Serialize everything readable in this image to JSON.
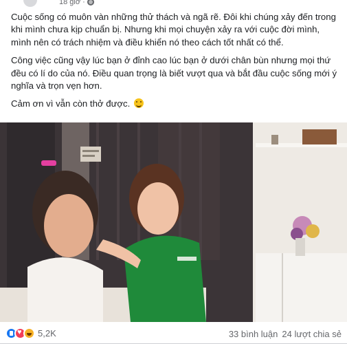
{
  "header": {
    "time": "18 giờ",
    "privacy_icon": "globe-icon"
  },
  "post": {
    "paragraphs": [
      "Cuộc sống có muôn vàn những thử thách và ngã rẽ. Đôi khi chúng xảy đến trong khi mình chưa kịp chuẩn bị. Nhưng khi mọi chuyện xảy ra với cuộc đời mình, mình nên có trách nhiệm và điều khiển nó theo cách tốt nhất có thể.",
      "Công việc cũng vậy lúc bạn ở đỉnh cao lúc bạn ở dưới chân bùn nhưng mọi thứ đều có lí do của nó. Điều quan trọng là biết vượt qua và bắt đầu cuộc sống mới ý nghĩa và trọn vẹn hơn."
    ],
    "closing": "Cảm ơn vì vẫn còn thở được.",
    "closing_emoji": "smile-emoji"
  },
  "footer": {
    "reactions": [
      "like",
      "love",
      "haha"
    ],
    "reaction_count": "5,2K",
    "comments": "33 bình luận",
    "shares": "24 lượt chia sẻ"
  },
  "colors": {
    "text": "#1c1e21",
    "secondary": "#65676b",
    "like": "#1877f2",
    "love": "#f33e58",
    "haha": "#f7b125"
  }
}
